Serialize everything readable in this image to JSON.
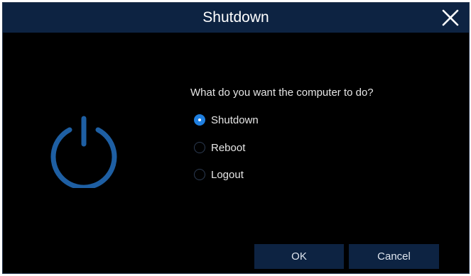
{
  "dialog": {
    "title": "Shutdown",
    "close_icon": "close-icon",
    "power_icon": "power-icon",
    "question": "What do you want the computer to do?",
    "options": [
      {
        "label": "Shutdown",
        "selected": true
      },
      {
        "label": "Reboot",
        "selected": false
      },
      {
        "label": "Logout",
        "selected": false
      }
    ],
    "ok_label": "OK",
    "cancel_label": "Cancel"
  },
  "colors": {
    "titlebar": "#0d2342",
    "background": "#000000",
    "accent": "#1f7fe0",
    "icon": "#1e5fa3"
  }
}
